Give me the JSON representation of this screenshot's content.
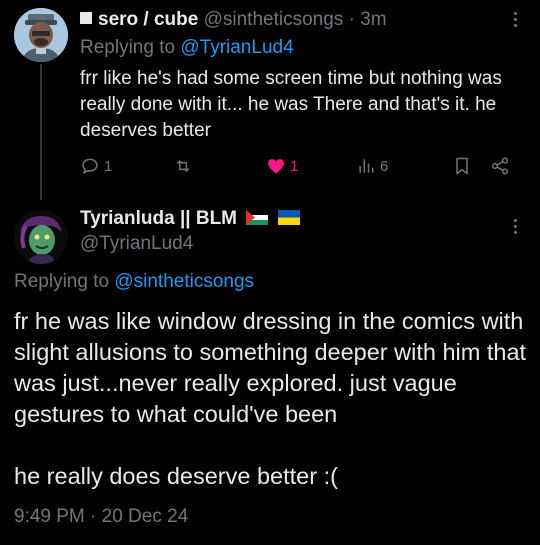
{
  "reply": {
    "display_name": "sero / cube",
    "handle": "@sintheticsongs",
    "time": "3m",
    "separator": "·",
    "replying_to_prefix": "Replying to",
    "replying_to_handle": "@TyrianLud4",
    "body": "frr like he's had some screen time but nothing was really done with it... he was There and that's it. he deserves better",
    "stats": {
      "replies": "1",
      "retweets": "",
      "likes": "1",
      "views": "6"
    },
    "liked": true
  },
  "main": {
    "display_name": "Tyrianluda || BLM",
    "handle": "@TyrianLud4",
    "replying_to_prefix": "Replying to",
    "replying_to_handle": "@sintheticsongs",
    "body": "fr he was like window dressing in the comics with slight allusions to something deeper with him that was just...never really explored. just vague gestures to what could've been\n\nhe really does deserve better :(",
    "timestamp": "9:49 PM · 20 Dec 24"
  },
  "colors": {
    "background": "#000000",
    "text": "#e7e9ea",
    "muted": "#71767b",
    "link": "#1d9bf0",
    "like": "#f91880",
    "thread_line": "#333639"
  }
}
